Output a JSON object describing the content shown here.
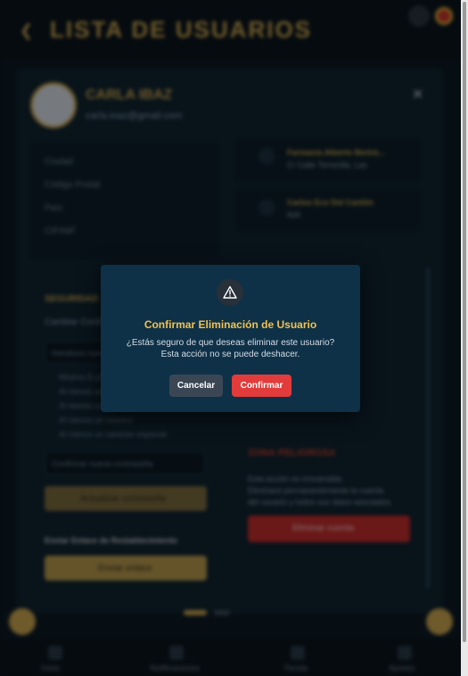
{
  "header": {
    "title": "LISTA DE USUARIOS",
    "back_icon": "chevron-left-icon"
  },
  "user": {
    "name": "CARLA IBAZ",
    "email": "carla.ioaz@gmail.com"
  },
  "profile_fields": [
    "Ciudad",
    "Código Postal",
    "País",
    "CIF/NIF"
  ],
  "addresses": [
    {
      "name": "Farmacia Alberto Bertrá...",
      "sub": "C/ Calle Torrecilla, Las"
    },
    {
      "name": "Carlos Eco Del Cantón",
      "sub": "N/A"
    }
  ],
  "security": {
    "title": "SEGURIDAD",
    "subtitle": "Cambiar Contraseña",
    "new_password_placeholder": "Introduce nueva contraseña",
    "requirements": [
      "Mínimo 8 caracteres",
      "Al menos una mayúscula",
      "Al menos una minúscula",
      "Al menos un número",
      "Al menos un carácter especial"
    ],
    "confirm_placeholder": "Confirmar nueva contraseña",
    "update_button": "Actualizar contraseña",
    "reset_title": "Enviar Enlace de Restablecimiento",
    "send_link_button": "Enviar enlace"
  },
  "danger_zone": {
    "title": "ZONA PELIGROSA",
    "text_lines": [
      "Esta acción es irreversible.",
      "Eliminará permanentemente la cuenta",
      "del usuario y todos sus datos asociados."
    ],
    "delete_button": "Eliminar cuenta"
  },
  "bottom_nav": [
    "Inicio",
    "Notificaciones",
    "Tienda",
    "Ajustes"
  ],
  "modal": {
    "icon": "warning-triangle-icon",
    "title": "Confirmar Eliminación de Usuario",
    "message": "¿Estás seguro de que deseas eliminar este usuario? Esta acción no se puede deshacer.",
    "cancel_label": "Cancelar",
    "confirm_label": "Confirmar"
  },
  "colors": {
    "accent_gold": "#f2c14e",
    "danger": "#e23b3b",
    "modal_bg": "#0e3148",
    "cancel_bg": "#3b4654"
  }
}
